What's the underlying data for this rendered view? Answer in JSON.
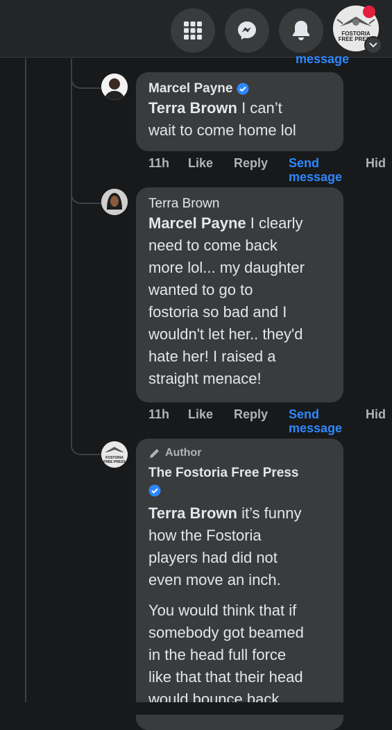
{
  "topbar": {
    "icons": [
      "menu-grid-icon",
      "messenger-icon",
      "bell-icon"
    ],
    "profile_logo_text": "FOSTORIA FREE PRESS"
  },
  "header_cut": {
    "send_label": "message"
  },
  "comments": [
    {
      "author": "Marcel Payne",
      "verified": true,
      "mention": "Terra Brown",
      "text_lines": [
        " I can’t",
        "wait to come home lol"
      ],
      "time": "11h",
      "like": "Like",
      "reply": "Reply",
      "send_line1": "Send",
      "send_line2": "message",
      "hide": "Hid"
    },
    {
      "author": "Terra Brown",
      "verified": false,
      "mention": "Marcel Payne",
      "text_lines": [
        " I clearly",
        "need to come back",
        "more lol... my daughter",
        "wanted to go to",
        "fostoria so bad and I",
        "wouldn't let her.. they'd",
        "hate her! I raised a",
        "straight menace!"
      ],
      "time": "11h",
      "like": "Like",
      "reply": "Reply",
      "send_line1": "Send",
      "send_line2": "message",
      "hide": "Hid"
    },
    {
      "author_badge": "Author",
      "author": "The Fostoria Free Press",
      "verified": true,
      "mention": "Terra Brown",
      "text_lines": [
        " it’s funny",
        "how the Fostoria",
        "players had did not",
        "even move an inch."
      ],
      "paragraph2_lines": [
        "You would think that if",
        "somebody got beamed",
        "in the head full force",
        "like that that their head",
        "would bounce back"
      ]
    }
  ],
  "colors": {
    "background": "#18191a",
    "bubble": "#3a3b3c",
    "link": "#2d88ff",
    "muted": "#b0b3b8",
    "verified": "#2d88ff"
  }
}
